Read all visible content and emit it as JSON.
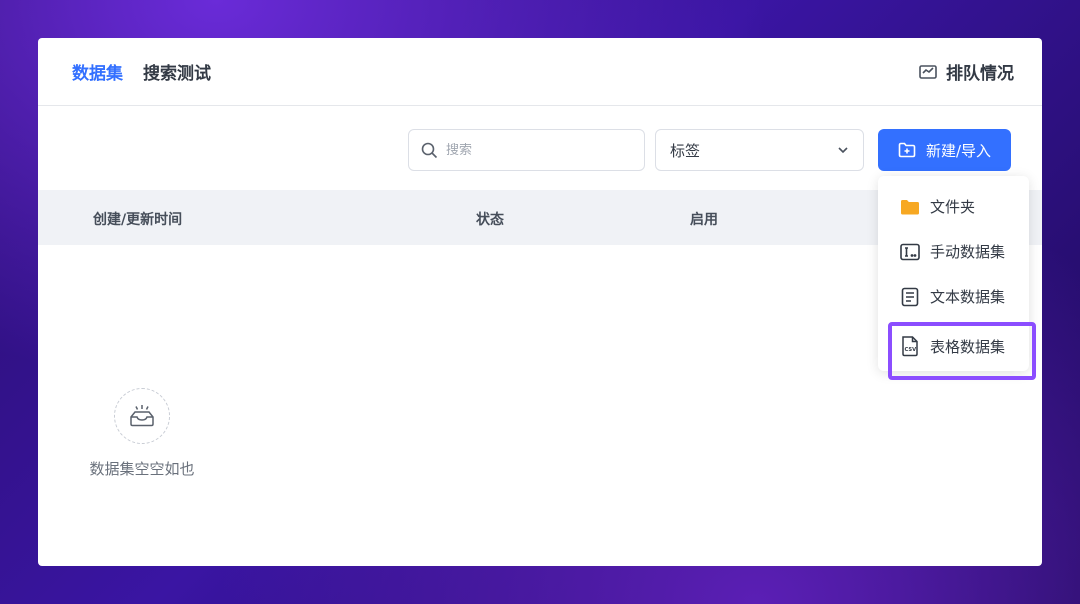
{
  "header": {
    "tabs": [
      {
        "label": "数据集",
        "active": true
      },
      {
        "label": "搜索测试",
        "active": false
      }
    ],
    "queue_label": "排队情况"
  },
  "toolbar": {
    "search_placeholder": "搜索",
    "tag_select_value": "标签",
    "new_button_label": "新建/导入"
  },
  "table": {
    "columns": [
      "创建/更新时间",
      "状态",
      "启用"
    ]
  },
  "empty_state": {
    "text": "数据集空空如也"
  },
  "dropdown_menu": {
    "items": [
      {
        "label": "文件夹",
        "icon": "folder-icon"
      },
      {
        "label": "手动数据集",
        "icon": "manual-dataset-icon"
      },
      {
        "label": "文本数据集",
        "icon": "text-dataset-icon"
      },
      {
        "label": "表格数据集",
        "icon": "csv-dataset-icon",
        "highlighted": true
      }
    ]
  },
  "colors": {
    "accent": "#3370ff",
    "highlight_border": "#8b4dff",
    "folder": "#f7a823"
  }
}
